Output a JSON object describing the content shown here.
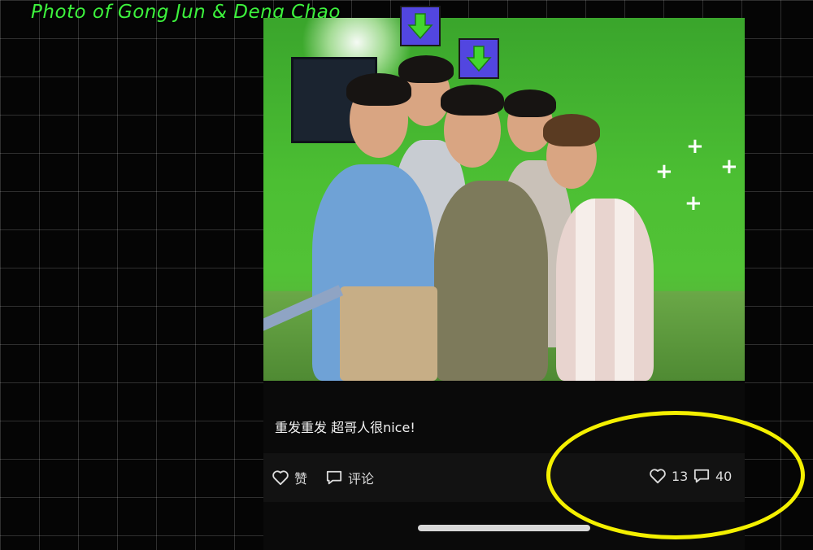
{
  "overlay": {
    "title": "Photo of Gong Jun & Deng Chao",
    "title_color": "#3df23d",
    "highlight_color": "#f4f000",
    "marker_color": "#5246e0",
    "marker_icon": "arrow-down-icon"
  },
  "post": {
    "photo_icon": "group-selfie-photo",
    "caption": "重发重发 超哥人很nice!",
    "actions": {
      "like_label": "赞",
      "like_icon": "heart-icon",
      "comment_label": "评论",
      "comment_icon": "comment-icon"
    },
    "stats": {
      "likes": "13",
      "comments": "40"
    }
  }
}
